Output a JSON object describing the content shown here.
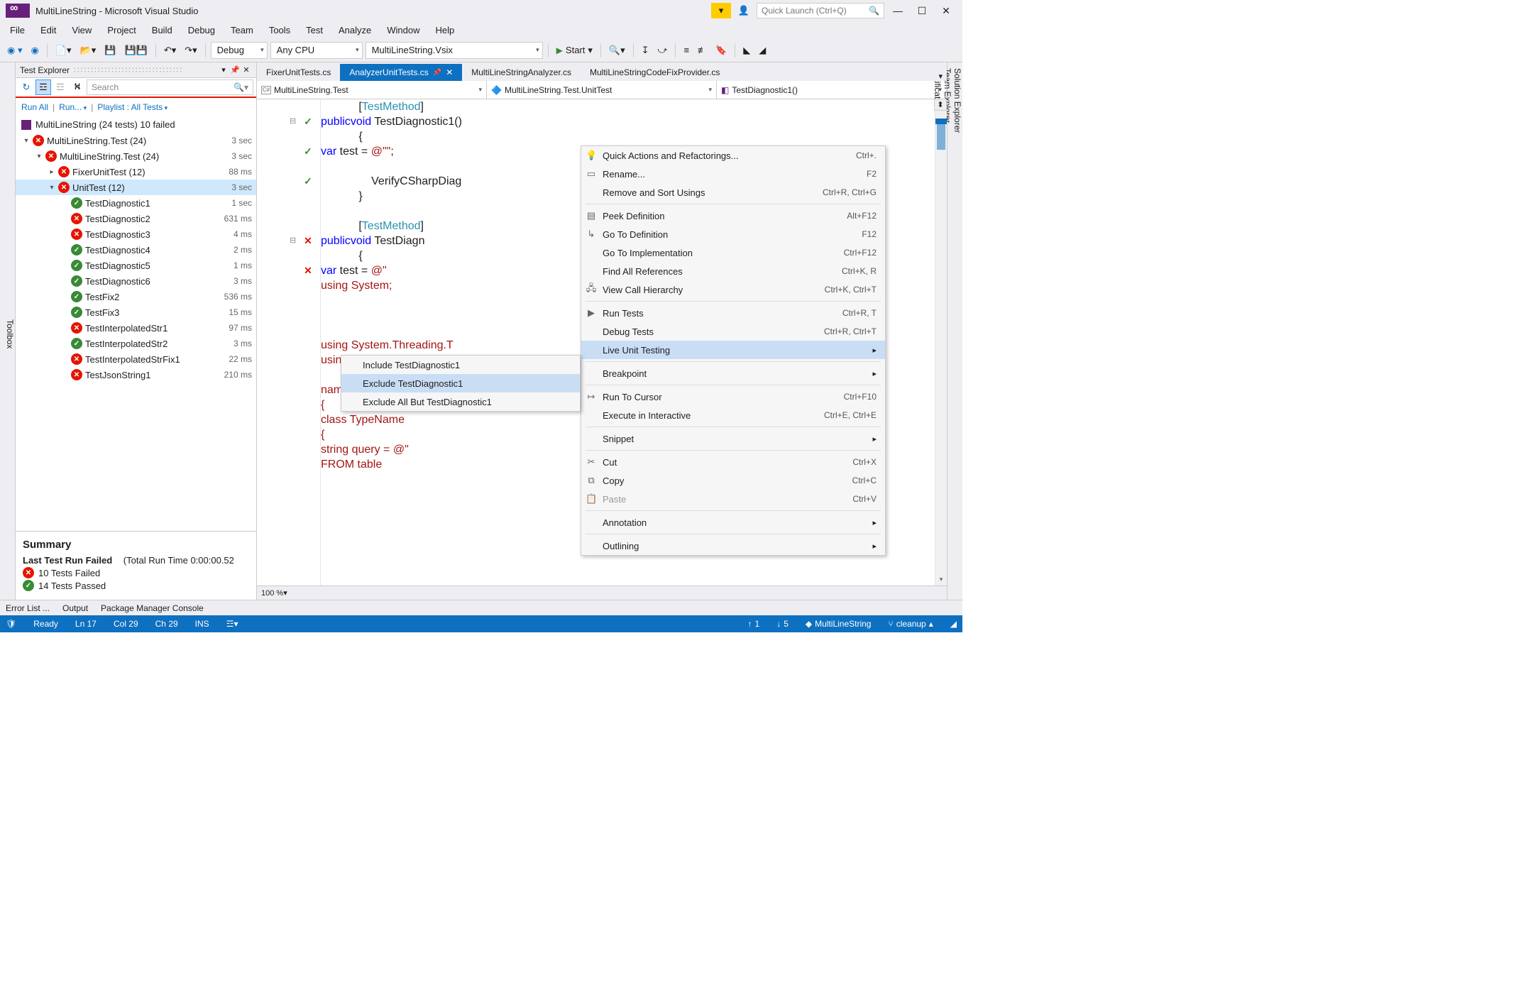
{
  "title": "MultiLineString - Microsoft Visual Studio",
  "quick_launch": "Quick Launch (Ctrl+Q)",
  "menu": [
    "File",
    "Edit",
    "View",
    "Project",
    "Build",
    "Debug",
    "Team",
    "Tools",
    "Test",
    "Analyze",
    "Window",
    "Help"
  ],
  "toolbar": {
    "config": "Debug",
    "platform": "Any CPU",
    "startup": "MultiLineString.Vsix",
    "start": "Start"
  },
  "left_tab": "Toolbox",
  "right_tabs": [
    "Solution Explorer",
    "Team Explorer",
    "Notifications"
  ],
  "test_explorer": {
    "title": "Test Explorer",
    "search_placeholder": "Search",
    "links": {
      "run_all": "Run All",
      "run": "Run...",
      "playlist": "Playlist : All Tests"
    },
    "top_summary": "MultiLineString (24 tests) 10 failed",
    "tree": [
      {
        "depth": 0,
        "icon": "fail",
        "name": "MultiLineString.Test (24)",
        "time": "3 sec",
        "tw": "▾"
      },
      {
        "depth": 1,
        "icon": "fail",
        "name": "MultiLineString.Test (24)",
        "time": "3 sec",
        "tw": "▾"
      },
      {
        "depth": 2,
        "icon": "fail",
        "name": "FixerUnitTest (12)",
        "time": "88 ms",
        "tw": "▸"
      },
      {
        "depth": 2,
        "icon": "fail",
        "name": "UnitTest (12)",
        "time": "3 sec",
        "tw": "▾",
        "sel": true
      },
      {
        "depth": 3,
        "icon": "pass",
        "name": "TestDiagnostic1",
        "time": "1 sec"
      },
      {
        "depth": 3,
        "icon": "fail",
        "name": "TestDiagnostic2",
        "time": "631 ms"
      },
      {
        "depth": 3,
        "icon": "fail",
        "name": "TestDiagnostic3",
        "time": "4 ms"
      },
      {
        "depth": 3,
        "icon": "pass",
        "name": "TestDiagnostic4",
        "time": "2 ms"
      },
      {
        "depth": 3,
        "icon": "pass",
        "name": "TestDiagnostic5",
        "time": "1 ms"
      },
      {
        "depth": 3,
        "icon": "pass",
        "name": "TestDiagnostic6",
        "time": "3 ms"
      },
      {
        "depth": 3,
        "icon": "pass",
        "name": "TestFix2",
        "time": "536 ms"
      },
      {
        "depth": 3,
        "icon": "pass",
        "name": "TestFix3",
        "time": "15 ms"
      },
      {
        "depth": 3,
        "icon": "fail",
        "name": "TestInterpolatedStr1",
        "time": "97 ms"
      },
      {
        "depth": 3,
        "icon": "pass",
        "name": "TestInterpolatedStr2",
        "time": "3 ms"
      },
      {
        "depth": 3,
        "icon": "fail",
        "name": "TestInterpolatedStrFix1",
        "time": "22 ms"
      },
      {
        "depth": 3,
        "icon": "fail",
        "name": "TestJsonString1",
        "time": "210 ms"
      }
    ],
    "summary": {
      "heading": "Summary",
      "last_run_label": "Last Test Run Failed",
      "last_run_detail": "(Total Run Time 0:00:00.52",
      "fail": "10 Tests Failed",
      "pass": "14 Tests Passed"
    }
  },
  "doc_tabs": [
    {
      "label": "FixerUnitTests.cs",
      "active": false
    },
    {
      "label": "AnalyzerUnitTests.cs",
      "active": true,
      "pinned": true
    },
    {
      "label": "MultiLineStringAnalyzer.cs",
      "active": false
    },
    {
      "label": "MultiLineStringCodeFixProvider.cs",
      "active": false
    }
  ],
  "nav": {
    "ns": "MultiLineString.Test",
    "cls": "MultiLineString.Test.UnitTest",
    "mth": "TestDiagnostic1()"
  },
  "code": [
    {
      "ind": 3,
      "html": "[<span class='type'>TestMethod</span>]"
    },
    {
      "ind": 3,
      "html": "<span class='kw'>public</span> <span class='kw'>void</span> TestDiagnostic1()",
      "fold": "⊟",
      "glyph": "pass",
      "beaker": "pass"
    },
    {
      "ind": 3,
      "html": "{"
    },
    {
      "ind": 4,
      "html": "<span class='kw'>var</span> test = <span class='str'>@\"\"</span>;",
      "glyph": "pass"
    },
    {
      "ind": 0,
      "html": ""
    },
    {
      "ind": 4,
      "html": "VerifyCSharpDiag",
      "glyph": "pass"
    },
    {
      "ind": 3,
      "html": "}"
    },
    {
      "ind": 0,
      "html": ""
    },
    {
      "ind": 3,
      "html": "[<span class='type'>TestMethod</span>]"
    },
    {
      "ind": 3,
      "html": "<span class='kw'>public</span> <span class='kw'>void</span> TestDiagn",
      "fold": "⊟",
      "glyph": "fail",
      "beaker": "fail"
    },
    {
      "ind": 3,
      "html": "{"
    },
    {
      "ind": 4,
      "html": "<span class='kw'>var</span> test = <span class='str'>@\"</span>",
      "glyph": "fail"
    },
    {
      "ind": 2,
      "html": "<span class='str'>using System;</span>"
    },
    {
      "ind": 0,
      "html": ""
    },
    {
      "ind": 0,
      "html": ""
    },
    {
      "ind": 0,
      "html": ""
    },
    {
      "ind": 2,
      "html": "<span class='str'>using System.Threading.T</span>",
      "hidden": true
    },
    {
      "ind": 2,
      "html": "<span class='str'>using System.Diagnostics</span>"
    },
    {
      "ind": 0,
      "html": ""
    },
    {
      "ind": 2,
      "html": "<span class='str'>namespace ConsoleApplica</span>"
    },
    {
      "ind": 2,
      "html": "<span class='str'>{</span>"
    },
    {
      "ind": 3,
      "html": "<span class='str'>class TypeName</span>"
    },
    {
      "ind": 3,
      "html": "<span class='str'>{</span>"
    },
    {
      "ind": 4,
      "html": "<span class='str'>string query = @\"</span>"
    },
    {
      "ind": 0,
      "html": "<span class='str'>FROM table</span>"
    }
  ],
  "zoom": "100 %",
  "context_menu": {
    "items": [
      {
        "label": "Quick Actions and Refactorings...",
        "sc": "Ctrl+.",
        "icon": "💡"
      },
      {
        "label": "Rename...",
        "sc": "F2",
        "icon": "▭"
      },
      {
        "label": "Remove and Sort Usings",
        "sc": "Ctrl+R, Ctrl+G"
      },
      {
        "sep": true
      },
      {
        "label": "Peek Definition",
        "sc": "Alt+F12",
        "icon": "▤"
      },
      {
        "label": "Go To Definition",
        "sc": "F12",
        "icon": "↳"
      },
      {
        "label": "Go To Implementation",
        "sc": "Ctrl+F12"
      },
      {
        "label": "Find All References",
        "sc": "Ctrl+K, R"
      },
      {
        "label": "View Call Hierarchy",
        "sc": "Ctrl+K, Ctrl+T",
        "icon": "🖧"
      },
      {
        "sep": true
      },
      {
        "label": "Run Tests",
        "sc": "Ctrl+R, T",
        "icon": "▶"
      },
      {
        "label": "Debug Tests",
        "sc": "Ctrl+R, Ctrl+T"
      },
      {
        "label": "Live Unit Testing",
        "sub": true,
        "hi": true
      },
      {
        "sep": true
      },
      {
        "label": "Breakpoint",
        "sub": true
      },
      {
        "sep": true
      },
      {
        "label": "Run To Cursor",
        "sc": "Ctrl+F10",
        "icon": "↦"
      },
      {
        "label": "Execute in Interactive",
        "sc": "Ctrl+E, Ctrl+E"
      },
      {
        "sep": true
      },
      {
        "label": "Snippet",
        "sub": true
      },
      {
        "sep": true
      },
      {
        "label": "Cut",
        "sc": "Ctrl+X",
        "icon": "✂"
      },
      {
        "label": "Copy",
        "sc": "Ctrl+C",
        "icon": "⧉"
      },
      {
        "label": "Paste",
        "sc": "Ctrl+V",
        "icon": "📋",
        "disabled": true
      },
      {
        "sep": true
      },
      {
        "label": "Annotation",
        "sub": true
      },
      {
        "sep": true
      },
      {
        "label": "Outlining",
        "sub": true
      }
    ]
  },
  "submenu": {
    "items": [
      {
        "label": "Include TestDiagnostic1"
      },
      {
        "label": "Exclude TestDiagnostic1",
        "hi": true
      },
      {
        "label": "Exclude All But TestDiagnostic1"
      }
    ]
  },
  "bottom_tabs": [
    "Error List ...",
    "Output",
    "Package Manager Console"
  ],
  "status": {
    "ready": "Ready",
    "ln": "Ln 17",
    "col": "Col 29",
    "ch": "Ch 29",
    "ins": "INS",
    "up": "1",
    "dn": "5",
    "repo": "MultiLineString",
    "branch": "cleanup"
  }
}
